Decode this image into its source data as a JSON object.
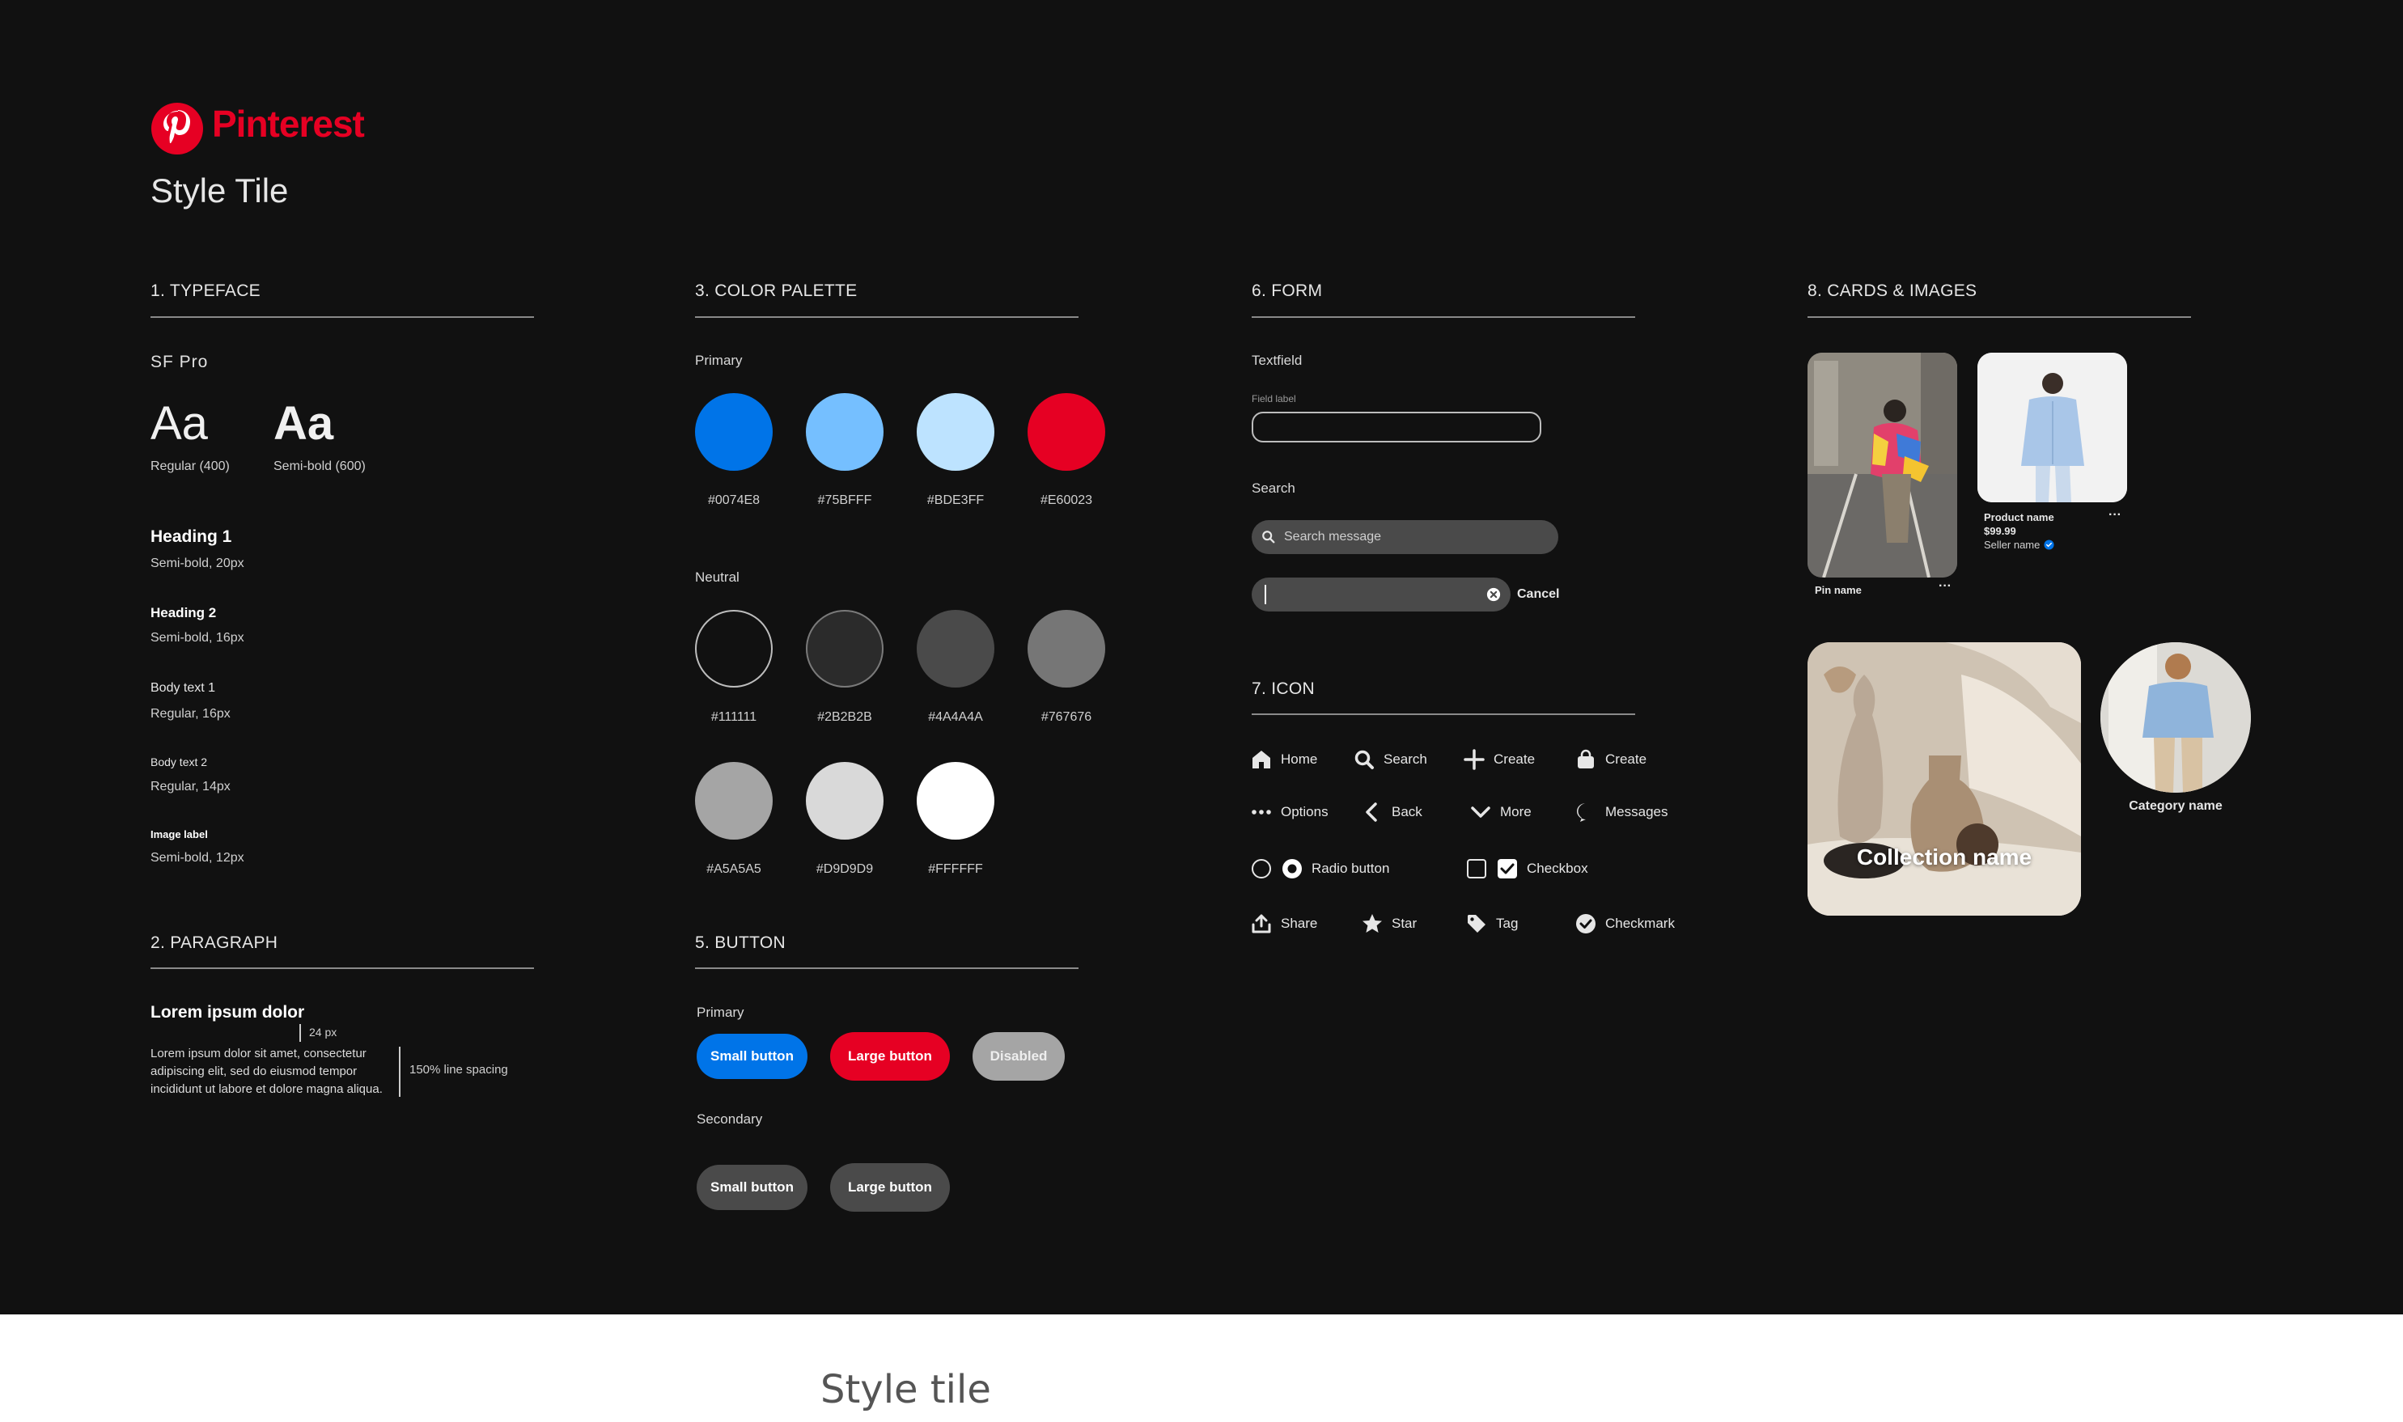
{
  "brand": {
    "name": "Pinterest",
    "logo_color": "#E60023"
  },
  "page_title": "Style Tile",
  "caption": "Style tile",
  "typeface": {
    "section": "1. TYPEFACE",
    "family": "SF Pro",
    "regular_sample": "Aa",
    "regular_label": "Regular (400)",
    "semibold_sample": "Aa",
    "semibold_label": "Semi-bold (600)",
    "styles": [
      {
        "name": "Heading 1",
        "spec": "Semi-bold, 20px"
      },
      {
        "name": "Heading 2",
        "spec": "Semi-bold, 16px"
      },
      {
        "name": "Body text 1",
        "spec": "Regular, 16px"
      },
      {
        "name": "Body text 2",
        "spec": "Regular, 14px"
      },
      {
        "name": "Image label",
        "spec": "Semi-bold, 12px"
      }
    ]
  },
  "paragraph": {
    "section": "2. PARAGRAPH",
    "heading": "Lorem ipsum dolor",
    "gap_label": "24 px",
    "body_lines": [
      "Lorem ipsum dolor sit amet, consectetur",
      "adipiscing elit, sed do eiusmod tempor",
      "incididunt ut labore et dolore magna aliqua."
    ],
    "line_spacing_label": "150% line spacing"
  },
  "palette": {
    "section": "3. COLOR PALETTE",
    "primary_label": "Primary",
    "primary": [
      "#0074E8",
      "#75BFFF",
      "#BDE3FF",
      "#E60023"
    ],
    "neutral_label": "Neutral",
    "neutral": [
      "#111111",
      "#2B2B2B",
      "#4A4A4A",
      "#767676",
      "#A5A5A5",
      "#D9D9D9",
      "#FFFFFF"
    ]
  },
  "buttons": {
    "section": "5. BUTTON",
    "primary_label": "Primary",
    "primary_small": "Small button",
    "primary_large": "Large button",
    "disabled": "Disabled",
    "secondary_label": "Secondary",
    "secondary_small": "Small button",
    "secondary_large": "Large button"
  },
  "form": {
    "section": "6. FORM",
    "textfield_label": "Textfield",
    "field_label": "Field label",
    "search_label": "Search",
    "search_placeholder": "Search message",
    "cancel": "Cancel"
  },
  "icons": {
    "section": "7. ICON",
    "items": {
      "home": "Home",
      "search": "Search",
      "create_plus": "Create",
      "create_bag": "Create",
      "options": "Options",
      "back": "Back",
      "more": "More",
      "messages": "Messages",
      "radio": "Radio button",
      "checkbox": "Checkbox",
      "share": "Share",
      "star": "Star",
      "tag": "Tag",
      "checkmark": "Checkmark"
    }
  },
  "cards": {
    "section": "8. CARDS & IMAGES",
    "pin_name": "Pin name",
    "product_name": "Product name",
    "product_price": "$99.99",
    "seller_name": "Seller name",
    "collection_name": "Collection name",
    "category_name": "Category name",
    "more_glyph": "···"
  }
}
